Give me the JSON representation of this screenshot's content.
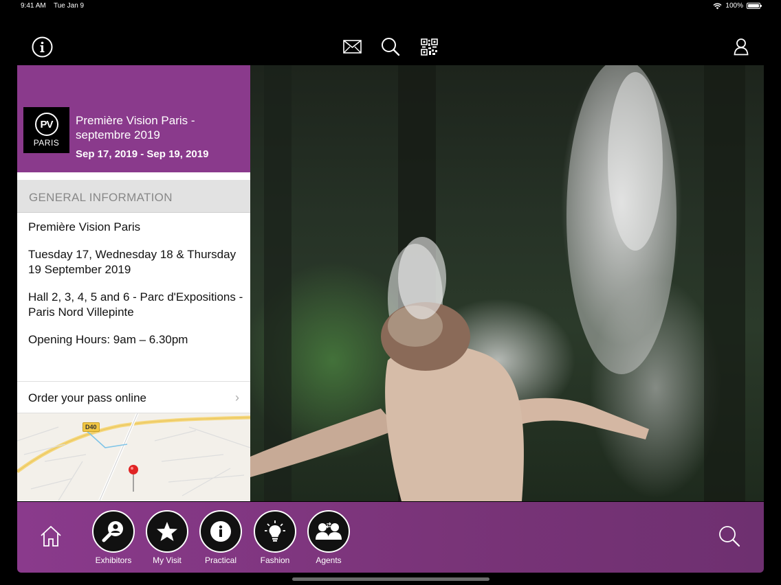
{
  "status_bar": {
    "time": "9:41 AM",
    "date": "Tue Jan 9",
    "battery": "100%",
    "battery_level": 1.0
  },
  "top_nav": {
    "icons": [
      "info-icon",
      "mail-icon",
      "search-icon",
      "qr-code-icon",
      "user-icon"
    ]
  },
  "event": {
    "logo_monogram": "PV",
    "logo_city": "PARIS",
    "title": "Première Vision Paris - septembre 2019",
    "dates": "Sep 17, 2019 - Sep 19, 2019"
  },
  "general_info": {
    "header": "GENERAL INFORMATION",
    "lines": [
      "Première Vision Paris",
      "Tuesday 17, Wednesday 18 & Thursday 19 September 2019",
      "Hall 2, 3, 4, 5 and 6 - Parc d'Expositions - Paris Nord Villepinte",
      "Opening Hours: 9am – 6.30pm"
    ],
    "order_label": "Order your pass online"
  },
  "map": {
    "road_label": "D40"
  },
  "bottom_bar": {
    "tabs": [
      {
        "label": "Exhibitors",
        "icon": "exhibitors-icon"
      },
      {
        "label": "My Visit",
        "icon": "star-icon"
      },
      {
        "label": "Practical",
        "icon": "info-icon"
      },
      {
        "label": "Fashion",
        "icon": "lightbulb-icon"
      },
      {
        "label": "Agents",
        "icon": "agents-icon"
      }
    ]
  },
  "colors": {
    "accent_purple": "#8a3a8c",
    "section_gray": "#e2e2e2"
  }
}
